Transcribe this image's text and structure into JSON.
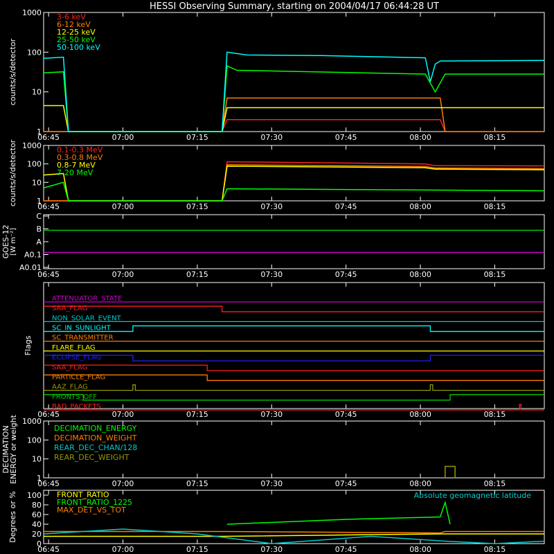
{
  "title": "HESSI Observing Summary, starting on 2004/04/17 06:44:28 UT",
  "time_ticks": [
    "06:45",
    "07:00",
    "07:15",
    "07:30",
    "07:45",
    "08:00",
    "08:15"
  ],
  "chart_data": [
    {
      "type": "line",
      "id": "rate-low",
      "ylabel": "counts/s/detector",
      "yscale": "log",
      "ylim": [
        1,
        1000
      ],
      "ytick_labels": [
        "1",
        "10",
        "100",
        "1000"
      ],
      "x_range": [
        "06:44",
        "08:25"
      ],
      "series": [
        {
          "name": "3-6 keV",
          "color": "#ff2020",
          "points": [
            [
              "06:44",
              1
            ],
            [
              "07:20",
              1
            ],
            [
              "07:21",
              2
            ],
            [
              "08:04",
              2
            ],
            [
              "08:05",
              1
            ],
            [
              "08:25",
              1
            ]
          ]
        },
        {
          "name": "6-12 keV",
          "color": "#ff8000",
          "points": [
            [
              "06:44",
              1
            ],
            [
              "07:20",
              1
            ],
            [
              "07:21",
              7
            ],
            [
              "08:04",
              7
            ],
            [
              "08:05",
              1
            ],
            [
              "08:25",
              1
            ]
          ]
        },
        {
          "name": "12-25 keV",
          "color": "#ffff00",
          "points": [
            [
              "06:44",
              4.5
            ],
            [
              "06:48",
              4.5
            ],
            [
              "06:49",
              1
            ],
            [
              "07:20",
              1
            ],
            [
              "07:21",
              4
            ],
            [
              "08:04",
              4
            ],
            [
              "08:05",
              4
            ],
            [
              "08:25",
              4
            ]
          ]
        },
        {
          "name": "25-50 keV",
          "color": "#00ff00",
          "points": [
            [
              "06:44",
              30
            ],
            [
              "06:48",
              32
            ],
            [
              "06:49",
              1
            ],
            [
              "07:20",
              1
            ],
            [
              "07:21",
              45
            ],
            [
              "07:23",
              35
            ],
            [
              "08:01",
              28
            ],
            [
              "08:03",
              10
            ],
            [
              "08:05",
              28
            ],
            [
              "08:25",
              28
            ]
          ]
        },
        {
          "name": "50-100 keV",
          "color": "#00ffff",
          "points": [
            [
              "06:44",
              70
            ],
            [
              "06:48",
              75
            ],
            [
              "06:49",
              1
            ],
            [
              "07:20",
              1
            ],
            [
              "07:21",
              100
            ],
            [
              "07:25",
              85
            ],
            [
              "07:40",
              82
            ],
            [
              "08:01",
              72
            ],
            [
              "08:02",
              18
            ],
            [
              "08:03",
              50
            ],
            [
              "08:04",
              60
            ],
            [
              "08:25",
              62
            ]
          ]
        }
      ]
    },
    {
      "type": "line",
      "id": "rate-high",
      "ylabel": "counts/s/detector",
      "yscale": "log",
      "ylim": [
        1,
        1000
      ],
      "ytick_labels": [
        "1",
        "10",
        "100",
        "1000"
      ],
      "x_range": [
        "06:44",
        "08:25"
      ],
      "series": [
        {
          "name": "0.1-0.3 MeV",
          "color": "#ff2020",
          "points": [
            [
              "06:44",
              1
            ],
            [
              "07:20",
              1
            ],
            [
              "07:21",
              130
            ],
            [
              "08:01",
              100
            ],
            [
              "08:03",
              80
            ],
            [
              "08:25",
              78
            ]
          ]
        },
        {
          "name": "0.3-0.8 MeV",
          "color": "#ff8000",
          "points": [
            [
              "06:44",
              1
            ],
            [
              "07:20",
              1
            ],
            [
              "07:21",
              90
            ],
            [
              "08:01",
              72
            ],
            [
              "08:03",
              60
            ],
            [
              "08:25",
              55
            ]
          ]
        },
        {
          "name": "0.8-7 MeV",
          "color": "#ffff00",
          "points": [
            [
              "06:44",
              25
            ],
            [
              "06:48",
              30
            ],
            [
              "06:49",
              1
            ],
            [
              "07:20",
              1
            ],
            [
              "07:21",
              75
            ],
            [
              "08:01",
              62
            ],
            [
              "08:03",
              52
            ],
            [
              "08:25",
              48
            ]
          ]
        },
        {
          "name": "7-20 MeV",
          "color": "#00ff00",
          "points": [
            [
              "06:44",
              5
            ],
            [
              "06:48",
              10
            ],
            [
              "06:49",
              1
            ],
            [
              "07:20",
              1
            ],
            [
              "07:21",
              4.5
            ],
            [
              "08:25",
              3.5
            ]
          ]
        }
      ]
    },
    {
      "type": "line",
      "id": "goes",
      "ylabel": "GOES-12",
      "yunit": "[W m⁻²]",
      "ytick_labels": [
        "C",
        "B",
        "A",
        "A0.1",
        "A0.01"
      ],
      "series": [
        {
          "name": "GOES long",
          "color": "#00cc00",
          "points": [
            [
              "06:44",
              "B"
            ],
            [
              "08:25",
              "B"
            ]
          ]
        },
        {
          "name": "GOES short",
          "color": "#cc00cc",
          "points": [
            [
              "06:44",
              "A0.1"
            ],
            [
              "08:25",
              "A0.1"
            ]
          ]
        }
      ]
    },
    {
      "type": "line",
      "id": "flags",
      "ylabel": "Flags",
      "series": [
        {
          "name": "ATTENUATOR_STATE",
          "color": "#cc00cc",
          "transitions": [
            [
              "06:44",
              0
            ]
          ]
        },
        {
          "name": "SAA_FLAG",
          "color": "#ff2020",
          "transitions": [
            [
              "06:44",
              1
            ],
            [
              "07:20",
              0
            ]
          ]
        },
        {
          "name": "NON_SOLAR_EVENT",
          "color": "#00cccc",
          "transitions": [
            [
              "06:44",
              0
            ]
          ]
        },
        {
          "name": "SC_IN_SUNLIGHT",
          "color": "#00ffff",
          "transitions": [
            [
              "06:44",
              0
            ],
            [
              "07:02",
              1
            ],
            [
              "08:02",
              0
            ]
          ]
        },
        {
          "name": "SC_TRANSMITTER",
          "color": "#ff8000",
          "transitions": [
            [
              "06:44",
              0
            ]
          ]
        },
        {
          "name": "FLARE_FLAG",
          "color": "#ffff00",
          "transitions": [
            [
              "06:44",
              0
            ]
          ]
        },
        {
          "name": "ECLIPSE_FLAG",
          "color": "#2020ff",
          "transitions": [
            [
              "06:44",
              1
            ],
            [
              "07:02",
              0
            ],
            [
              "08:02",
              1
            ]
          ]
        },
        {
          "name": "SAA_FLAG",
          "color": "#ff2020",
          "transitions": [
            [
              "06:44",
              1
            ],
            [
              "07:17",
              0
            ]
          ]
        },
        {
          "name": "PARTICLE_FLAG",
          "color": "#ff8000",
          "transitions": [
            [
              "06:44",
              1
            ],
            [
              "07:17",
              0
            ]
          ]
        },
        {
          "name": "AAZ_FLAG",
          "color": "#999900",
          "transitions": [
            [
              "06:44",
              0
            ],
            [
              "07:02",
              1
            ],
            [
              "07:02.5",
              0
            ],
            [
              "08:02",
              1
            ],
            [
              "08:02.5",
              0
            ]
          ]
        },
        {
          "name": "FRONTS_OFF",
          "color": "#00cc00",
          "transitions": [
            [
              "06:44",
              1
            ],
            [
              "06:52",
              0
            ],
            [
              "08:06",
              1
            ]
          ]
        },
        {
          "name": "BAD_PACKETS",
          "color": "#ff2020",
          "transitions": [
            [
              "06:44",
              0
            ],
            [
              "08:20",
              1
            ],
            [
              "08:20.3",
              0
            ]
          ]
        }
      ]
    },
    {
      "type": "line",
      "id": "decimation",
      "ylabel": "DECIMATION",
      "ylabel2": "ENERGY or weight",
      "yscale": "log",
      "ylim": [
        1,
        1000
      ],
      "ytick_labels": [
        "1",
        "10",
        "100",
        "1000"
      ],
      "series": [
        {
          "name": "DECIMATION_ENERGY",
          "color": "#00ff00",
          "points": []
        },
        {
          "name": "DECIMATION_WEIGHT",
          "color": "#ff8000",
          "points": []
        },
        {
          "name": "REAR_DEC_CHAN/128",
          "color": "#00cccc",
          "points": []
        },
        {
          "name": "REAR_DEC_WEIGHT",
          "color": "#999900",
          "points": [
            [
              "08:05",
              1
            ],
            [
              "08:05",
              4
            ],
            [
              "08:07",
              4
            ],
            [
              "08:07",
              1
            ]
          ]
        }
      ]
    },
    {
      "type": "line",
      "id": "ratios",
      "ylabel": "Degrees or %",
      "ylim": [
        0,
        110
      ],
      "ytick_labels": [
        "0",
        "20",
        "40",
        "60",
        "80",
        "100"
      ],
      "annotation": "Absolute geomagnetic latitude",
      "series": [
        {
          "name": "FRONT_RATIO",
          "color": "#ffff00",
          "points": [
            [
              "06:44",
              15
            ],
            [
              "07:20",
              15
            ],
            [
              "08:04",
              20
            ],
            [
              "08:25",
              20
            ]
          ]
        },
        {
          "name": "FRONT_RATIO_1225",
          "color": "#00ff00",
          "points": [
            [
              "07:21",
              40
            ],
            [
              "07:45",
              50
            ],
            [
              "08:04",
              55
            ],
            [
              "08:05",
              85
            ],
            [
              "08:06",
              40
            ]
          ]
        },
        {
          "name": "MAX_DET_VS_TOT",
          "color": "#ff8000",
          "points": [
            [
              "06:44",
              25
            ],
            [
              "06:48",
              25
            ],
            [
              "07:21",
              25
            ],
            [
              "08:04",
              22
            ],
            [
              "08:05",
              25
            ],
            [
              "08:25",
              25
            ]
          ]
        },
        {
          "name": "Absolute geomagnetic latitude",
          "color": "#00cccc",
          "points": [
            [
              "06:44",
              20
            ],
            [
              "07:00",
              30
            ],
            [
              "07:15",
              20
            ],
            [
              "07:30",
              0
            ],
            [
              "07:50",
              15
            ],
            [
              "08:05",
              5
            ],
            [
              "08:15",
              0
            ],
            [
              "08:25",
              5
            ]
          ]
        }
      ]
    }
  ]
}
